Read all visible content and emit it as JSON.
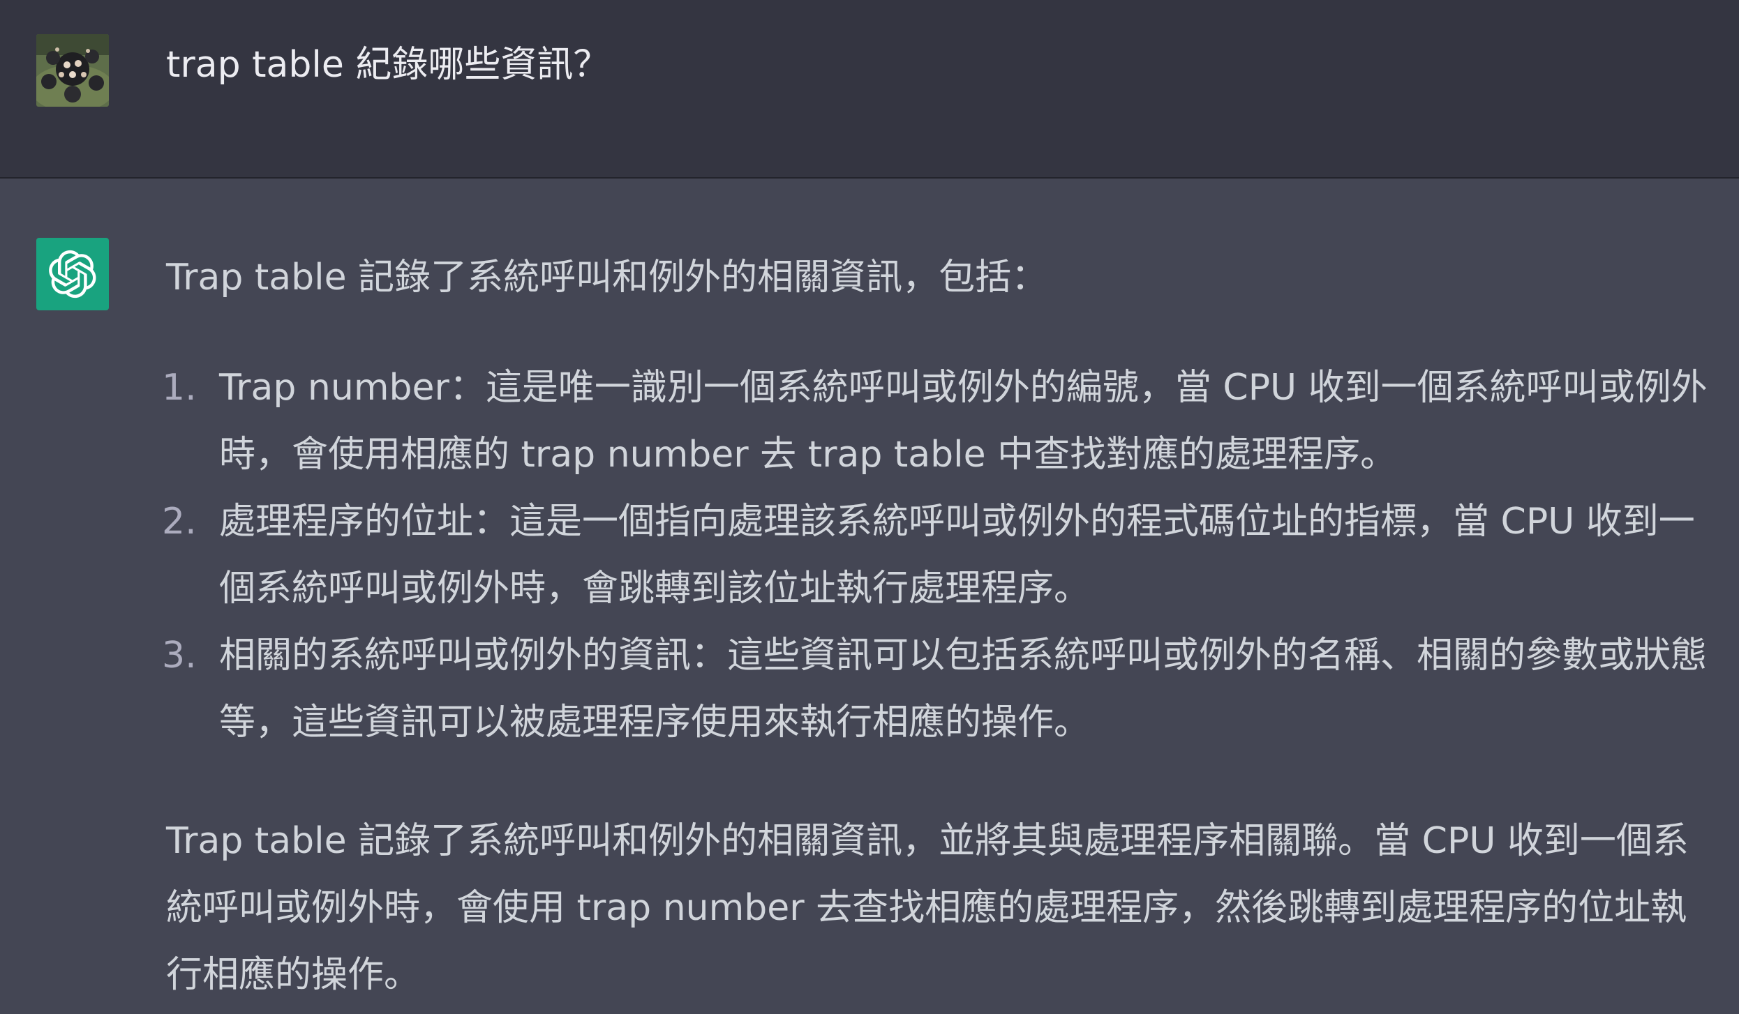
{
  "conversation": {
    "user_message": "trap table 紀錄哪些資訊？",
    "assistant": {
      "intro": "Trap table 記錄了系統呼叫和例外的相關資訊，包括：",
      "items": [
        {
          "number": "1.",
          "text": "Trap number：這是唯一識別一個系統呼叫或例外的編號，當 CPU 收到一個系統呼叫或例外時，會使用相應的 trap number 去 trap table 中查找對應的處理程序。"
        },
        {
          "number": "2.",
          "text": "處理程序的位址：這是一個指向處理該系統呼叫或例外的程式碼位址的指標，當 CPU 收到一個系統呼叫或例外時，會跳轉到該位址執行處理程序。"
        },
        {
          "number": "3.",
          "text": "相關的系統呼叫或例外的資訊：這些資訊可以包括系統呼叫或例外的名稱、相關的參數或狀態等，這些資訊可以被處理程序使用來執行相應的操作。"
        }
      ],
      "summary": "Trap table 記錄了系統呼叫和例外的相關資訊，並將其與處理程序相關聯。當 CPU 收到一個系統呼叫或例外時，會使用 trap number 去查找相應的處理程序，然後跳轉到處理程序的位址執行相應的操作。"
    }
  },
  "icons": {
    "user_avatar": "user-avatar-photo",
    "assistant_avatar": "openai-logo-icon"
  },
  "colors": {
    "user_bg": "#343541",
    "assistant_bg": "#444654",
    "openai_green": "#19a37f",
    "text": "#d1d5db"
  }
}
